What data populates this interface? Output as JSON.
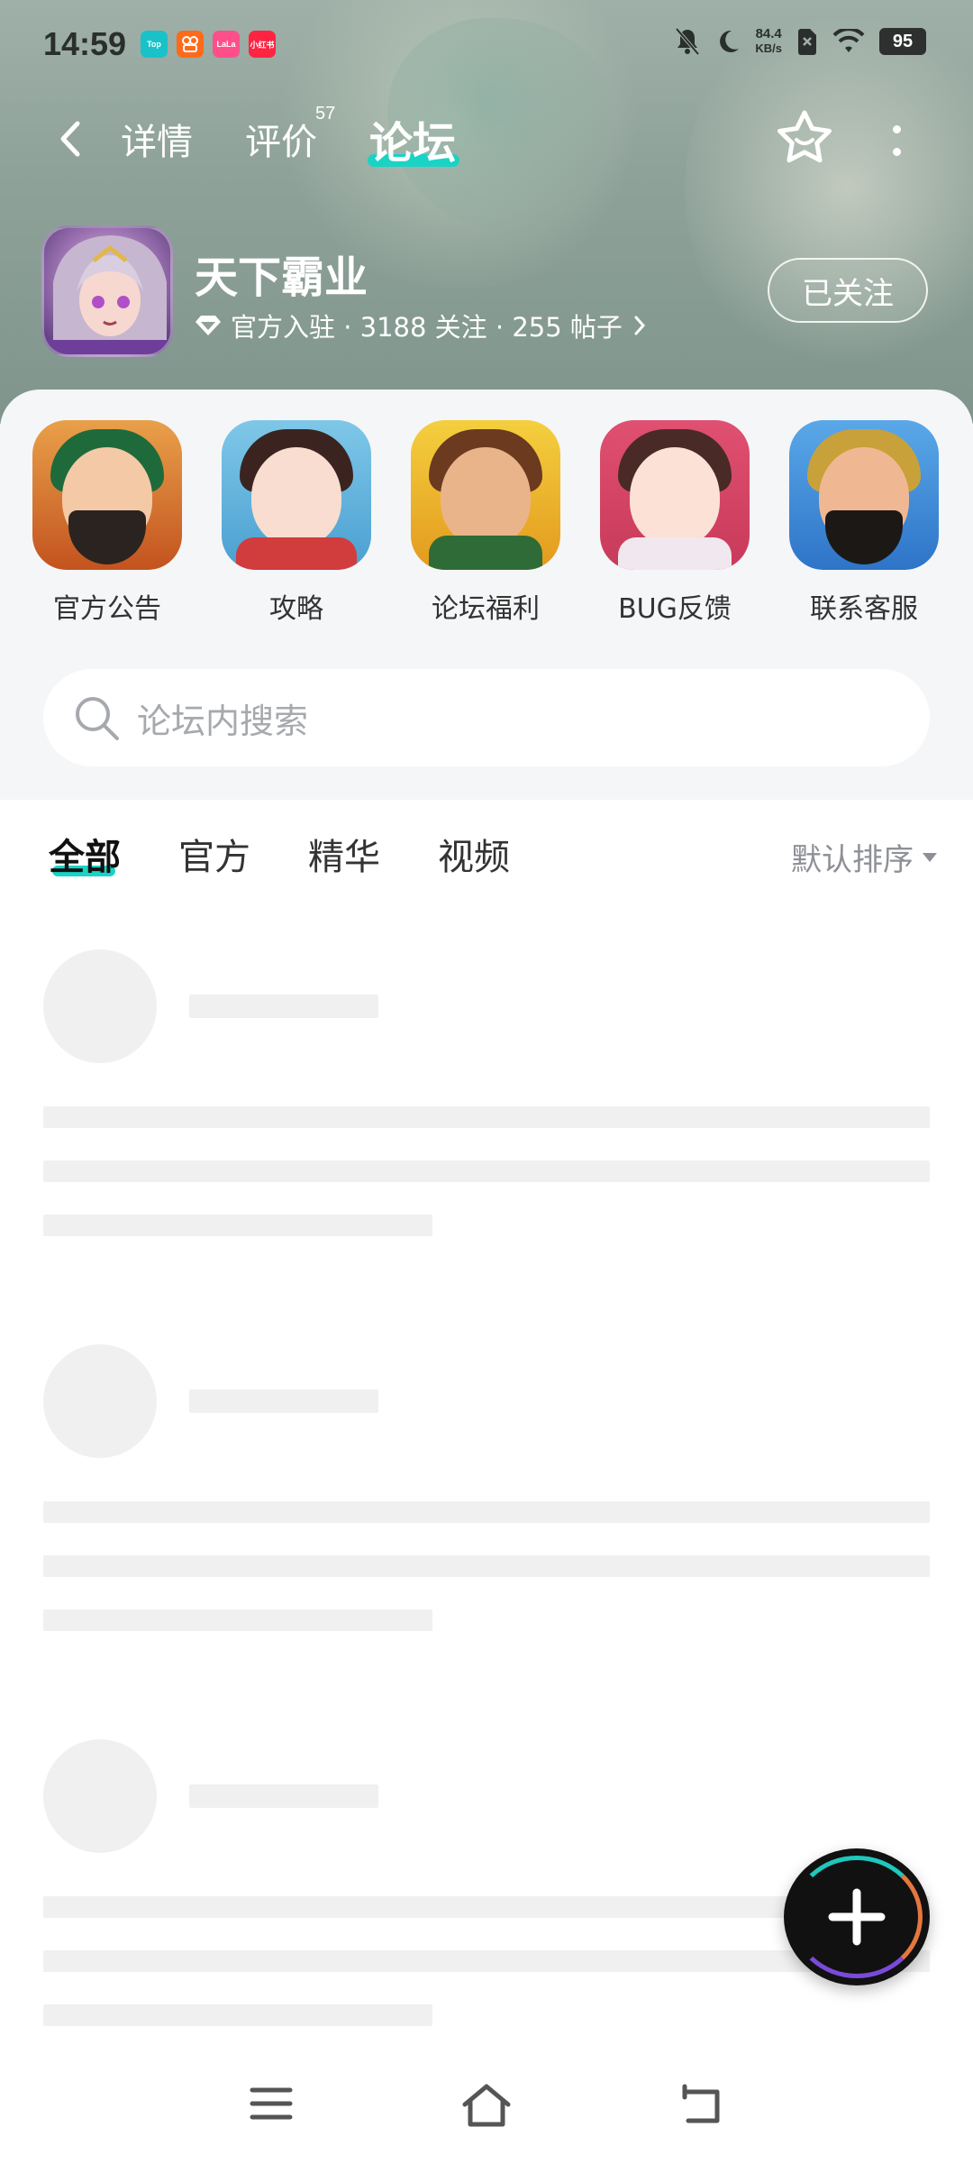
{
  "status_bar": {
    "time": "14:59",
    "mini_apps": [
      {
        "label": "Top",
        "color": "#19c2c9"
      },
      {
        "label": "",
        "color": "#ff6a1a"
      },
      {
        "label": "LaLa",
        "color": "#ff4f8b"
      },
      {
        "label": "小红书",
        "color": "#ff2442"
      }
    ],
    "net_speed_value": "84.4",
    "net_speed_unit": "KB/s",
    "battery": "95"
  },
  "top_nav": {
    "tabs": [
      {
        "label": "详情"
      },
      {
        "label": "评价",
        "badge": "57"
      },
      {
        "label": "论坛"
      }
    ],
    "active_tab": "论坛",
    "accent_color": "#19d3c5"
  },
  "game": {
    "title": "天下霸业",
    "meta": "官方入驻 · 3188 关注 · 255 帖子",
    "follow_label": "已关注"
  },
  "shortcuts": [
    {
      "label": "官方公告",
      "icon": "guan-yu-avatar-icon"
    },
    {
      "label": "攻略",
      "icon": "heroine-avatar-icon"
    },
    {
      "label": "论坛福利",
      "icon": "warrior-avatar-icon"
    },
    {
      "label": "BUG反馈",
      "icon": "girl-avatar-icon"
    },
    {
      "label": "联系客服",
      "icon": "zhang-fei-avatar-icon"
    }
  ],
  "search": {
    "placeholder": "论坛内搜索"
  },
  "filter_tabs": [
    {
      "label": "全部"
    },
    {
      "label": "官方"
    },
    {
      "label": "精华"
    },
    {
      "label": "视频"
    }
  ],
  "sort_label": "默认排序"
}
